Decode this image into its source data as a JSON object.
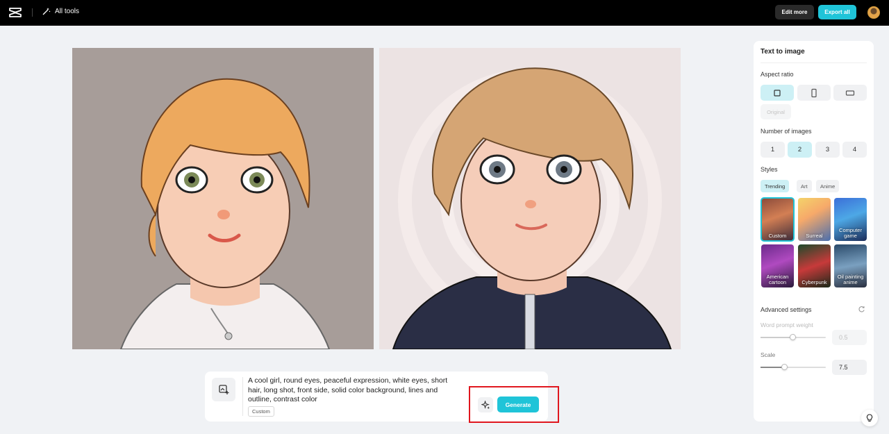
{
  "header": {
    "all_tools_label": "All tools",
    "edit_more_label": "Edit more",
    "export_all_label": "Export all"
  },
  "prompt": {
    "text": "A cool girl, round eyes, peaceful expression, white eyes, short hair, long shot, front side, solid color background, lines and outline, contrast color",
    "style_tag": "Custom",
    "generate_label": "Generate"
  },
  "panel": {
    "title": "Text to image",
    "aspect_ratio_label": "Aspect ratio",
    "original_label": "Original",
    "number_of_images_label": "Number of images",
    "numbers": [
      "1",
      "2",
      "3",
      "4"
    ],
    "selected_number": "2",
    "styles_label": "Styles",
    "style_tabs": [
      "Trending",
      "Art",
      "Anime"
    ],
    "style_items": [
      {
        "label": "Custom"
      },
      {
        "label": "Surreal"
      },
      {
        "label": "Computer game"
      },
      {
        "label": "American cartoon"
      },
      {
        "label": "Cyberpunk"
      },
      {
        "label": "Oil painting anime"
      }
    ],
    "advanced_settings_label": "Advanced settings",
    "word_prompt_weight_label": "Word prompt weight",
    "word_prompt_weight_value": "0.5",
    "scale_label": "Scale",
    "scale_value": "7.5"
  },
  "colors": {
    "accent": "#1fc4d8",
    "accent_light": "#cdf0f5",
    "highlight_box": "#e0161e"
  }
}
